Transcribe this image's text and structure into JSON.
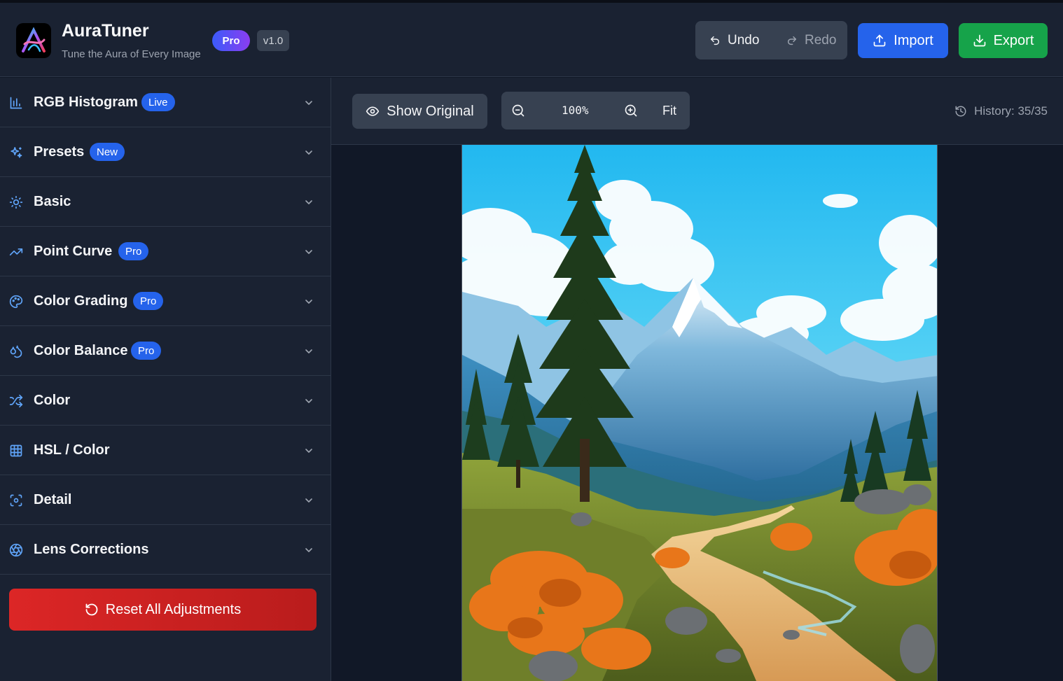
{
  "app": {
    "title": "AuraTuner",
    "subtitle": "Tune the Aura of Every Image",
    "plan_badge": "Pro",
    "version": "v1.0"
  },
  "header_actions": {
    "undo": "Undo",
    "redo": "Redo",
    "import": "Import",
    "export": "Export"
  },
  "sidebar": {
    "panels": [
      {
        "label": "RGB Histogram",
        "badge": "Live",
        "icon": "bar-chart-icon"
      },
      {
        "label": "Presets",
        "badge": "New",
        "icon": "sparkles-icon"
      },
      {
        "label": "Basic",
        "badge": "",
        "icon": "sun-icon"
      },
      {
        "label": "Point Curve",
        "badge": "Pro",
        "icon": "trending-up-icon"
      },
      {
        "label": "Color Grading",
        "badge": "Pro",
        "icon": "palette-icon"
      },
      {
        "label": "Color Balance",
        "badge": "Pro",
        "icon": "droplets-icon"
      },
      {
        "label": "Color",
        "badge": "",
        "icon": "shuffle-icon"
      },
      {
        "label": "HSL / Color",
        "badge": "",
        "icon": "grid-icon"
      },
      {
        "label": "Detail",
        "badge": "",
        "icon": "focus-icon"
      },
      {
        "label": "Lens Corrections",
        "badge": "",
        "icon": "aperture-icon"
      }
    ],
    "reset_label": "Reset All Adjustments"
  },
  "viewer": {
    "show_original": "Show Original",
    "zoom_level": "100%",
    "fit": "Fit",
    "history": "History: 35/35"
  },
  "colors": {
    "accent_blue": "#2563eb",
    "export_green": "#16a34a",
    "reset_red": "#dc2626",
    "icon_blue": "#60a5fa"
  }
}
